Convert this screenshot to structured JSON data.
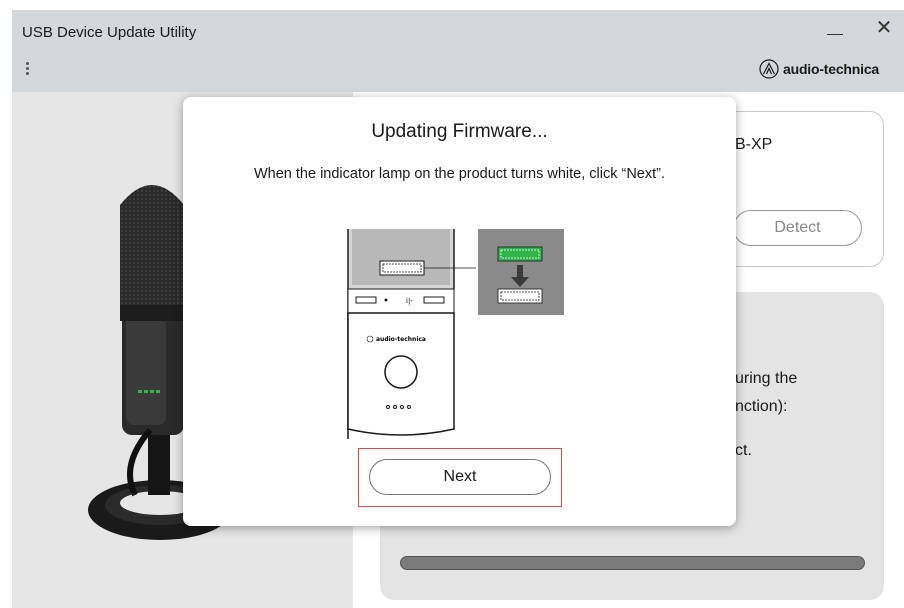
{
  "window": {
    "title": "USB Device Update Utility",
    "minimize_icon": "minimize-icon",
    "close_label": "✕"
  },
  "header": {
    "menu_icon": "kebab-menu-icon",
    "brand": "audio-technica"
  },
  "device_card": {
    "model_fragment": "B-XP",
    "detect_label": "Detect"
  },
  "info_card": {
    "lines": [
      "uring the",
      "nction):",
      "ct."
    ],
    "progress_fraction": 1.0
  },
  "dialog": {
    "title": "Updating Firmware...",
    "message": "When the indicator lamp on the product turns white, click “Next”.",
    "illustration_brand": "audio-technica",
    "next_label": "Next"
  },
  "colors": {
    "titlebar_bg": "#d3d8dc",
    "left_pane_bg": "#e6e6e6",
    "highlight_red": "#d84a4a",
    "indicator_green": "#2fb54a"
  }
}
